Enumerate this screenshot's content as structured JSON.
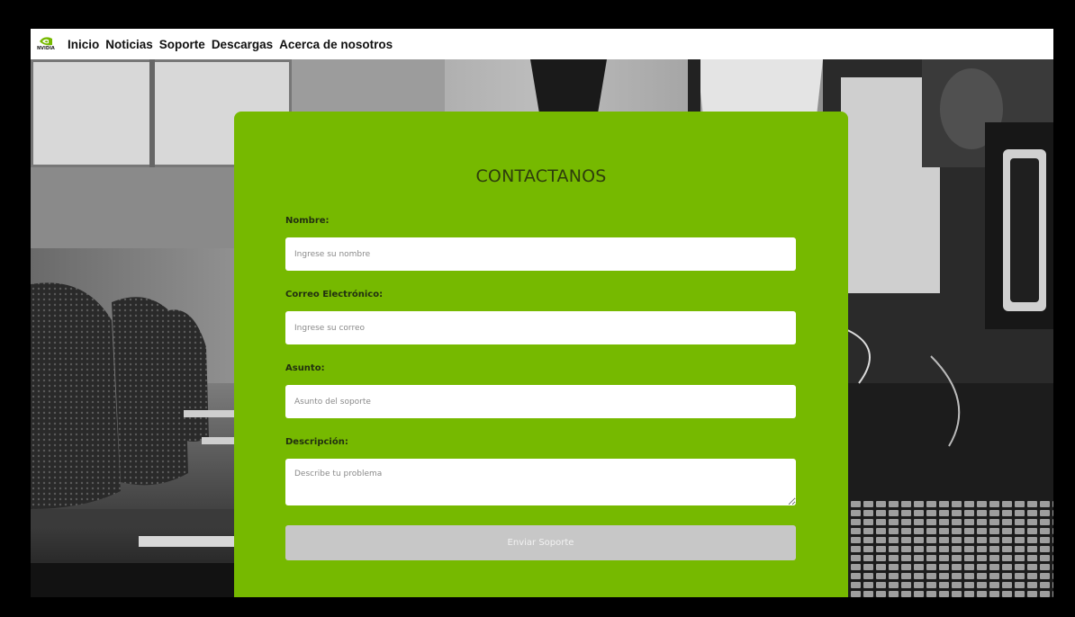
{
  "nav": {
    "logo_text": "NVIDIA",
    "links": [
      "Inicio",
      "Noticias",
      "Soporte",
      "Descargas",
      "Acerca de nosotros"
    ]
  },
  "form": {
    "title": "CONTACTANOS",
    "name_label": "Nombre:",
    "name_placeholder": "Ingrese su nombre",
    "email_label": "Correo Electrónico:",
    "email_placeholder": "Ingrese su correo",
    "subject_label": "Asunto:",
    "subject_placeholder": "Asunto del soporte",
    "description_label": "Descripción:",
    "description_placeholder": "Describe tu problema",
    "submit_label": "Enviar Soporte"
  },
  "colors": {
    "brand_green": "#76b900",
    "submit_disabled": "#c7c7c7",
    "title_text": "#2e3d0c"
  }
}
